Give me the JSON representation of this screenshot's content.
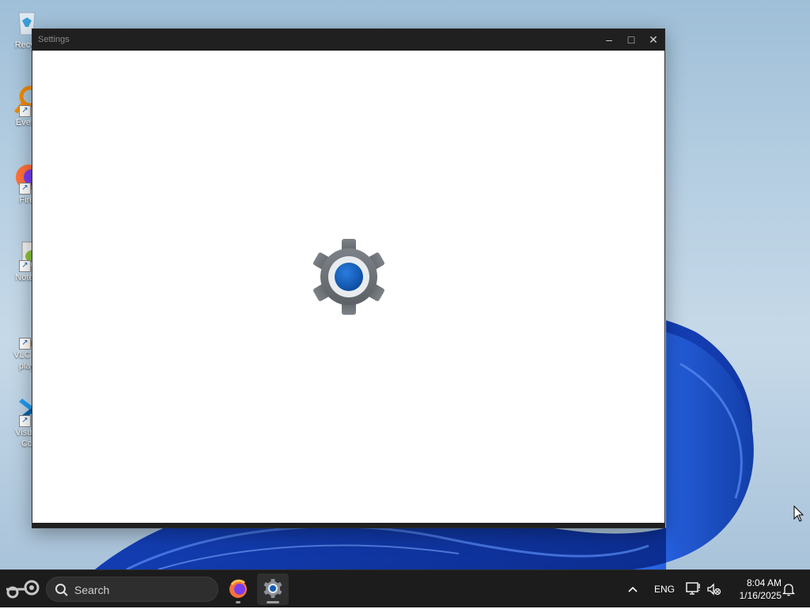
{
  "desktop": {
    "icons": [
      {
        "label": "Recycle Bin",
        "visible_label": "Recyc"
      },
      {
        "label": "Everything",
        "visible_label": "Every"
      },
      {
        "label": "Firefox",
        "visible_label": "Fire"
      },
      {
        "label": "Notepad++",
        "visible_label": "Notep"
      },
      {
        "label": "VLC media player",
        "visible_label": "VLC m",
        "visible_label_2": "play"
      },
      {
        "label": "Visual Studio Code",
        "visible_label": "Visual",
        "visible_label_2": "Co"
      }
    ]
  },
  "window": {
    "title": "Settings",
    "minimize_glyph": "–",
    "maximize_glyph": "□",
    "close_glyph": "✕",
    "splash_icon": "settings-gear-icon"
  },
  "taskbar": {
    "search_label": "Search",
    "apps": [
      {
        "name": "Firefox",
        "icon": "firefox-icon"
      },
      {
        "name": "Settings",
        "icon": "settings-gear-icon"
      }
    ],
    "tray": {
      "chevron_glyph": "^",
      "language": "ENG",
      "time": "8:04 AM",
      "date": "1/16/2025"
    }
  },
  "colors": {
    "taskbar_bg": "#1c1c1c",
    "titlebar_bg": "#202020",
    "accent": "#0f5cb4"
  }
}
